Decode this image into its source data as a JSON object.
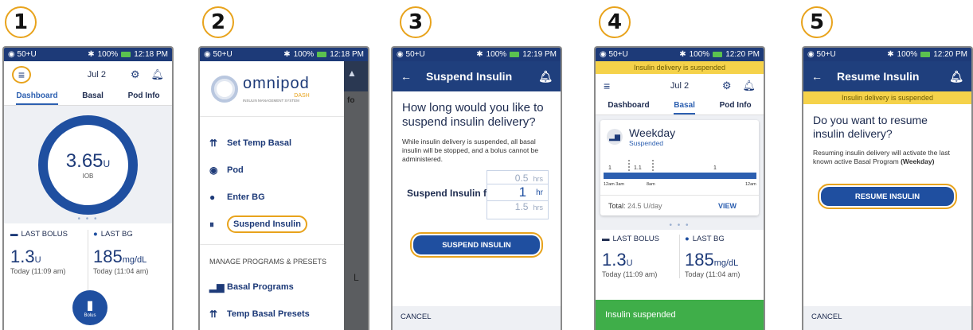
{
  "steps": [
    "1",
    "2",
    "3",
    "4",
    "5"
  ],
  "status": {
    "reservoir": "50+U",
    "battery": "100%",
    "times": [
      "12:18 PM",
      "12:18 PM",
      "12:19 PM",
      "12:20 PM",
      "12:20 PM"
    ]
  },
  "screen1": {
    "date": "Jul 2",
    "tabs": [
      "Dashboard",
      "Basal",
      "Pod Info"
    ],
    "iob_value": "3.65",
    "iob_unit": "U",
    "iob_label": "IOB",
    "last_bolus_label": "LAST BOLUS",
    "last_bolus_value": "1.3",
    "last_bolus_unit": "U",
    "last_bolus_time": "Today (11:09 am)",
    "last_bg_label": "LAST BG",
    "last_bg_value": "185",
    "last_bg_unit": "mg/dL",
    "last_bg_time": "Today (11:04 am)",
    "bolus_label": "Bolus"
  },
  "screen2": {
    "logo_text": "omnipod",
    "logo_sub": "DASH",
    "logo_tag": "INSULIN MANAGEMENT SYSTEM",
    "menu": [
      "Set Temp Basal",
      "Pod",
      "Enter BG",
      "Suspend Insulin"
    ],
    "section_header": "MANAGE PROGRAMS & PRESETS",
    "menu2": [
      "Basal Programs",
      "Temp Basal Presets"
    ],
    "peek_tab": "fo",
    "peek_letter": "L"
  },
  "screen3": {
    "title": "Suspend Insulin",
    "question": "How long would you like to suspend insulin delivery?",
    "body": "While insulin delivery is suspended, all basal insulin will be stopped, and a bolus cannot be administered.",
    "field_label": "Suspend Insulin f",
    "picker": [
      {
        "value": "0.5",
        "unit": "hrs"
      },
      {
        "value": "1",
        "unit": "hr"
      },
      {
        "value": "1.5",
        "unit": "hrs"
      }
    ],
    "button": "SUSPEND INSULIN",
    "cancel": "CANCEL"
  },
  "screen4": {
    "banner": "Insulin delivery is suspended",
    "date": "Jul 2",
    "tabs": [
      "Dashboard",
      "Basal",
      "Pod Info"
    ],
    "program_name": "Weekday",
    "program_status": "Suspended",
    "graph_values": [
      "1",
      "1.1",
      "1"
    ],
    "axis_labels": [
      "12am 3am",
      "8am",
      "12am"
    ],
    "total_label": "Total:",
    "total_value": "24.5 U/day",
    "view": "VIEW",
    "last_bolus_label": "LAST BOLUS",
    "last_bolus_value": "1.3",
    "last_bolus_unit": "U",
    "last_bolus_time": "Today (11:09 am)",
    "last_bg_label": "LAST BG",
    "last_bg_value": "185",
    "last_bg_unit": "mg/dL",
    "last_bg_time": "Today (11:04 am)",
    "toast": "Insulin suspended"
  },
  "screen5": {
    "title": "Resume Insulin",
    "banner": "Insulin delivery is suspended",
    "question": "Do you want to resume insulin delivery?",
    "body": "Resuming insulin delivery will activate the last known active Basal Program",
    "body_bold": "(Weekday)",
    "button": "RESUME INSULIN",
    "cancel": "CANCEL"
  },
  "colors": {
    "navy": "#1d3a78",
    "blue": "#1f4fa0",
    "orange": "#e8a31c",
    "yellow": "#f5d24a",
    "green": "#3fae49"
  }
}
